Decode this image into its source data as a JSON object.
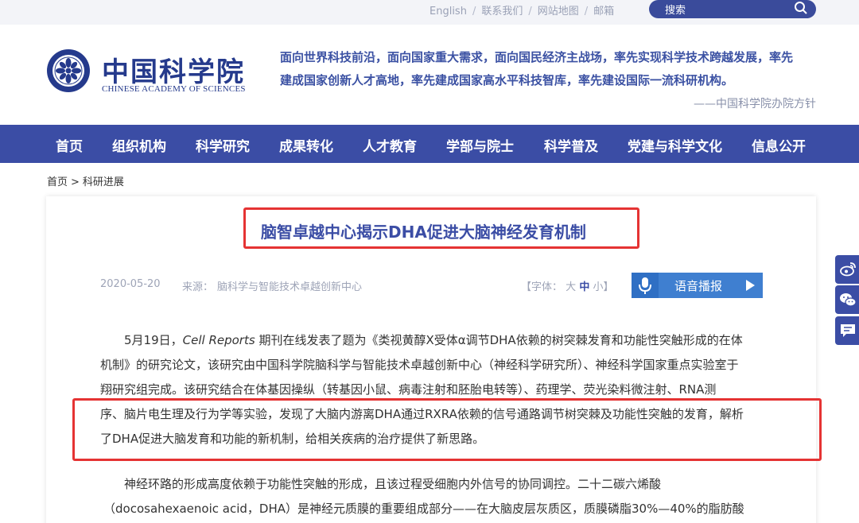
{
  "topbar": {
    "links": [
      "English",
      "联系我们",
      "网站地图",
      "邮箱"
    ],
    "separator": "/",
    "search_placeholder": "搜索"
  },
  "header": {
    "logo_cn": "中国科学院",
    "logo_en": "CHINESE ACADEMY OF SCIENCES",
    "slogan_line1": "面向世界科技前沿，面向国家重大需求，面向国民经济主战场，率先实现科学技术跨越发展，率先",
    "slogan_line2": "建成国家创新人才高地，率先建成国家高水平科技智库，率先建设国际一流科研机构。",
    "slogan_source": "——中国科学院办院方针"
  },
  "nav": {
    "items": [
      "首页",
      "组织机构",
      "科学研究",
      "成果转化",
      "人才教育",
      "学部与院士",
      "科学普及",
      "党建与科学文化",
      "信息公开"
    ]
  },
  "breadcrumb": {
    "home": "首页",
    "separator": ">",
    "current": "科研进展"
  },
  "article": {
    "title": "脑智卓越中心揭示DHA促进大脑神经发育机制",
    "date": "2020-05-20",
    "source_label": "来源：",
    "source": "脑科学与智能技术卓越创新中心",
    "font_size": {
      "prefix": "【字体：",
      "large": "大",
      "medium": "中",
      "small": "小",
      "suffix": "】"
    },
    "speak_label": "语音播报",
    "p1": {
      "line1_a": "5月19日，",
      "line1_journal": "Cell Reports",
      "line1_b": " 期刊在线发表了题为《类视黄醇X受体α调节DHA依赖的树突棘发育和功能性突触形成的在体",
      "line2": "机制》的研究论文，该研究由中国科学院脑科学与智能技术卓越创新中心（神经科学研究所）、神经科学国家重点实验室于",
      "line3": "翔研究组完成。该研究结合在体基因操纵（转基因小鼠、病毒注射和胚胎电转等）、药理学、荧光染料微注射、RNA测",
      "line4": "序、脑片电生理及行为学等实验，发现了大脑内游离DHA通过RXRA依赖的信号通路调节树突棘及功能性突触的发育，解析",
      "line5": "了DHA促进大脑发育和功能的新机制，给相关疾病的治疗提供了新思路。"
    },
    "p2": {
      "line1": "神经环路的形成高度依赖于功能性突触的形成，且该过程受细胞内外信号的协同调控。二十二碳六烯酸",
      "line2": "（docosahexaenoic acid，DHA）是神经元质膜的重要组成部分——在大脑皮层灰质区，质膜磷脂30%—40%的脂肪酸"
    }
  },
  "share": {
    "icons": [
      "weibo-icon",
      "wechat-icon",
      "comment-icon"
    ]
  },
  "colors": {
    "brand_blue": "#3b4da5",
    "highlight_red": "#e53333",
    "speak_blue": "#3f7fd0"
  }
}
